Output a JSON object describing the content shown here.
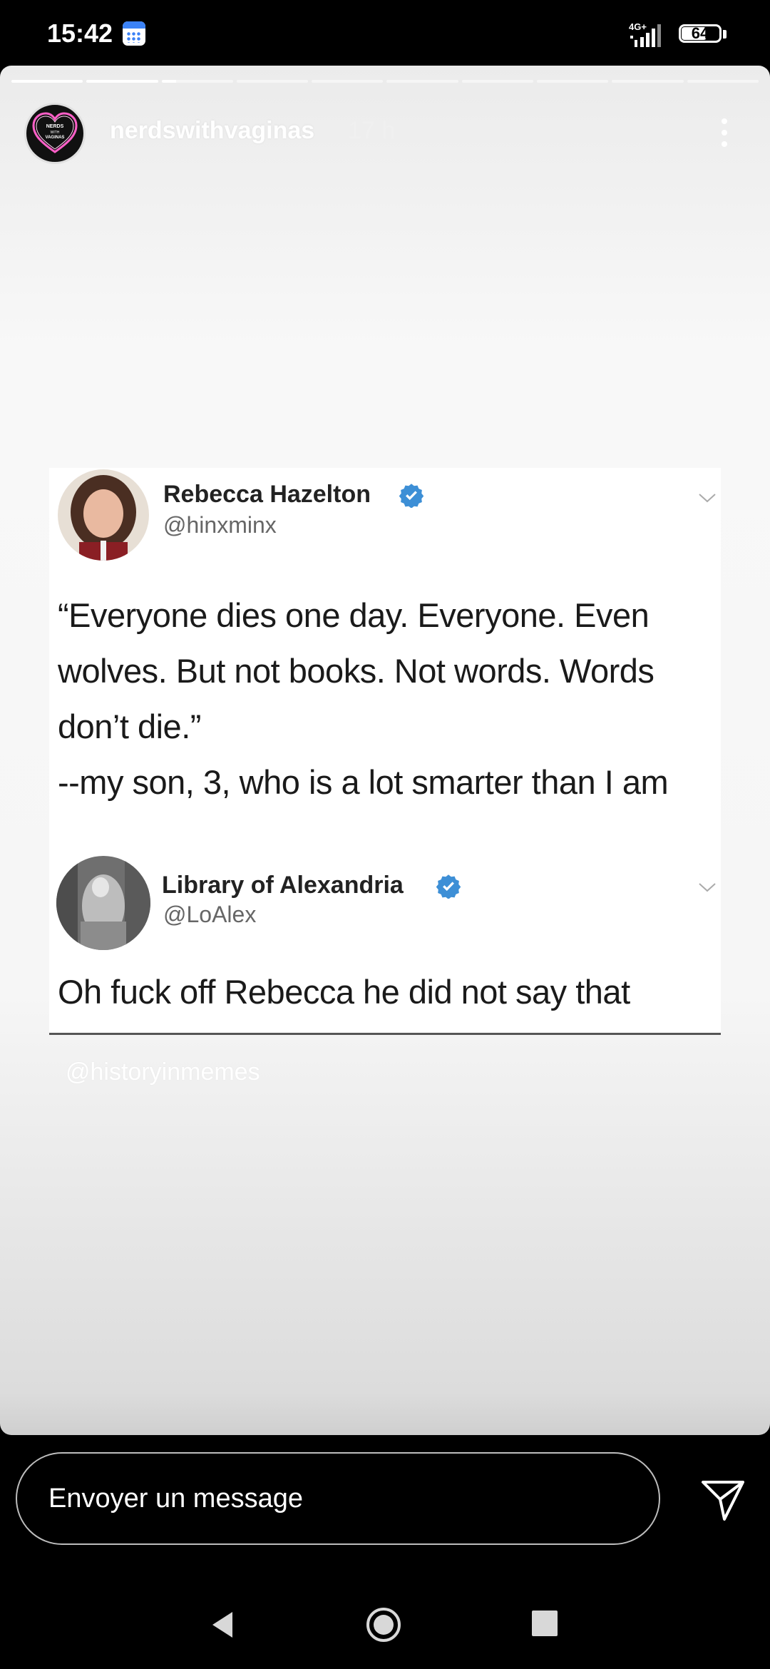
{
  "status_bar": {
    "time": "15:42",
    "network": "4G+",
    "battery": "64"
  },
  "story": {
    "progress": {
      "segments": 10,
      "current_index": 2,
      "current_fraction": 0.2
    },
    "username": "nerdswithvaginas",
    "age": "17 h",
    "avatar_text": "NERDS WITH VAGINAS",
    "tweets": [
      {
        "name": "Rebecca Hazelton",
        "handle": "@hinxminx",
        "lines": [
          "“Everyone dies one day. Everyone. Even",
          "wolves. But not books. Not words. Words",
          "don’t die.”",
          "--my son, 3, who is a lot smarter than I am"
        ]
      },
      {
        "name": "Library of Alexandria",
        "handle": "@LoAlex",
        "lines": [
          "Oh fuck off Rebecca he did not say that"
        ]
      }
    ],
    "watermark": "@historyinmemes"
  },
  "composer": {
    "placeholder": "Envoyer un message"
  },
  "colors": {
    "verified": "#1d9bf0",
    "story_bg": "#f6f6f6"
  }
}
